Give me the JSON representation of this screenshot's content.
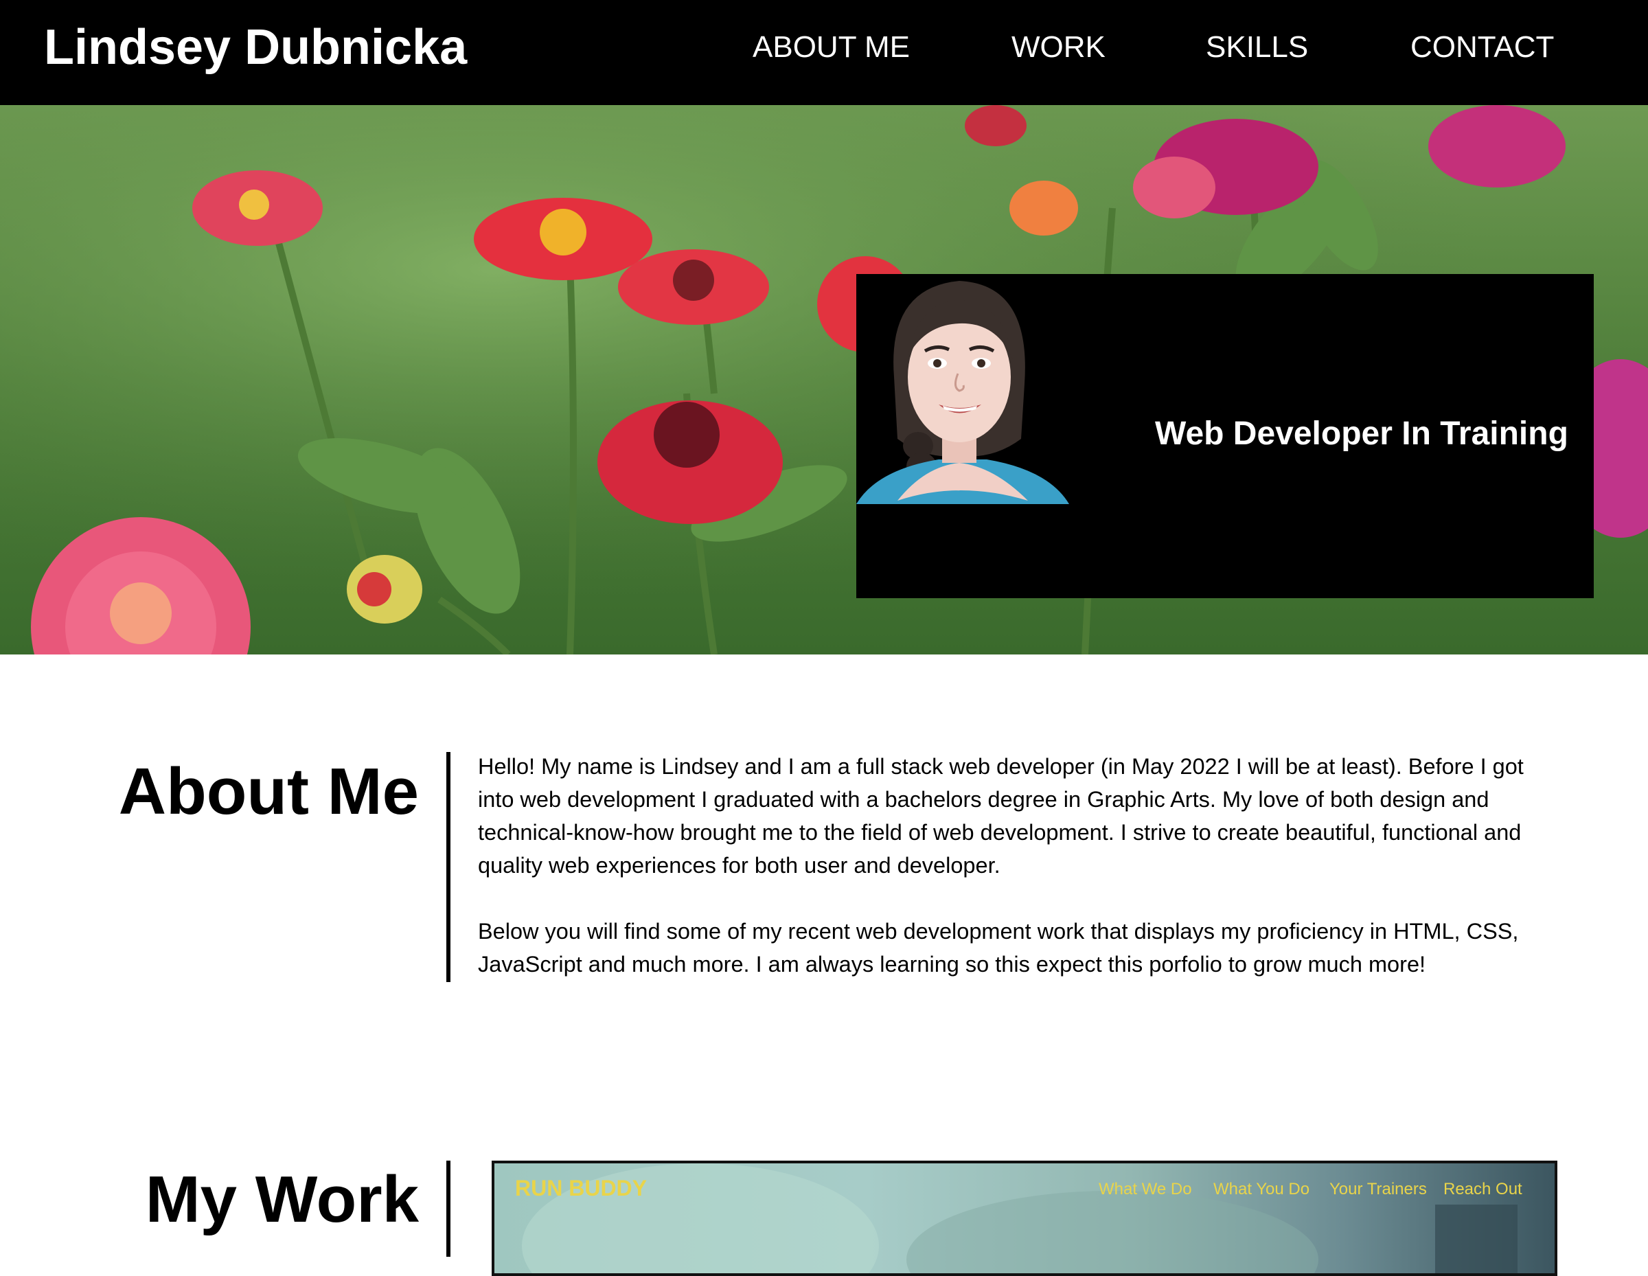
{
  "header": {
    "brand": "Lindsey Dubnicka",
    "nav": [
      "ABOUT ME",
      "WORK",
      "SKILLS",
      "CONTACT"
    ]
  },
  "hero": {
    "tagline": "Web Developer In Training",
    "avatar_icon": "cartoon-avatar-icon"
  },
  "about": {
    "title": "About Me",
    "paragraphs": [
      "Hello! My name is Lindsey and I am a full stack web developer (in May 2022 I will be at least). Before I got into web development I graduated with a bachelors degree in Graphic Arts. My love of both design and technical-know-how brought me to the field of web development. I strive to create beautiful, functional and quality web experiences for both user and developer.",
      "Below you will find some of my recent web development work that displays my proficiency in HTML, CSS, JavaScript and much more. I am always learning so this expect this porfolio to grow much more!"
    ]
  },
  "work": {
    "title": "My Work",
    "project": {
      "logo": "RUN BUDDY",
      "nav": [
        "What We Do",
        "What You Do",
        "Your Trainers",
        "Reach Out"
      ]
    }
  },
  "colors": {
    "header_bg": "#000000",
    "accent_yellow": "#e9d44a"
  }
}
